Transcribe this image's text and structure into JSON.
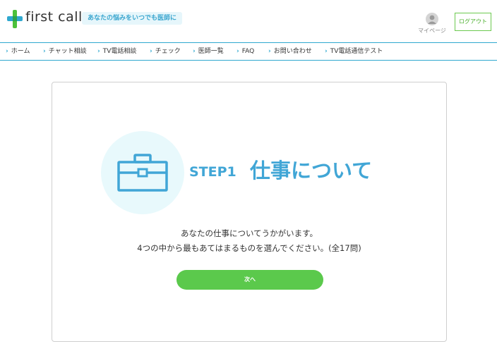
{
  "header": {
    "brand": "first call",
    "tagline": "あなたの悩みをいつでも医師に",
    "mypage_label": "マイページ",
    "logout_label": "ログアウト"
  },
  "nav": {
    "items": [
      {
        "label": "ホーム"
      },
      {
        "label": "チャット相談"
      },
      {
        "label": "TV電話相談"
      },
      {
        "label": "チェック"
      },
      {
        "label": "医師一覧"
      },
      {
        "label": "FAQ"
      },
      {
        "label": "お問い合わせ"
      },
      {
        "label": "TV電話通信テスト"
      }
    ]
  },
  "main": {
    "step_label": "STEP1",
    "step_title": "仕事について",
    "description_line1": "あなたの仕事についてうかがいます。",
    "description_line2": "4つの中から最もあてはまるものを選んでください。(全17問)",
    "next_button": "次へ"
  },
  "icons": [
    "logo-icon",
    "user-avatar-icon",
    "chevron-right-icon",
    "briefcase-icon"
  ],
  "colors": {
    "accent_blue": "#41a6d6",
    "nav_border": "#2fa8cf",
    "button_green": "#5bc94c",
    "logout_green": "#4cb02e",
    "circle_bg": "#e8f9fc"
  }
}
